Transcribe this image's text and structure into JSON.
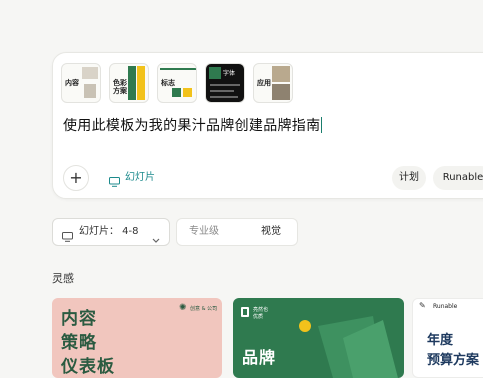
{
  "composer": {
    "templates": [
      {
        "label": "内容"
      },
      {
        "label": "色彩",
        "label2": "方案"
      },
      {
        "label": "标志"
      },
      {
        "label": "字体"
      },
      {
        "label": "应用"
      }
    ],
    "prompt_text": "使用此模板为我的果汁品牌创建品牌指南",
    "add_icon": "plus-icon",
    "mode_label": "幻灯片",
    "plan_label": "计划",
    "runable_label": "Runable"
  },
  "options": {
    "slides_selector": "幻灯片：  4-8",
    "level_label": "专业级",
    "visual_label": "视觉"
  },
  "inspiration": {
    "title": "灵感",
    "cards": [
      {
        "lines": [
          "内容",
          "策略",
          "仪表板"
        ],
        "brand": "创意 & 公司"
      },
      {
        "title": "品牌",
        "brand_line1": "亮然也",
        "brand_line2": "优质"
      },
      {
        "brand": "Runable",
        "lines": [
          "年度",
          "预算方案"
        ]
      }
    ]
  },
  "colors": {
    "accent": "#1c8a8c",
    "green": "#2f7a4f",
    "pink": "#f1c6be",
    "yellow": "#f2c21b"
  }
}
